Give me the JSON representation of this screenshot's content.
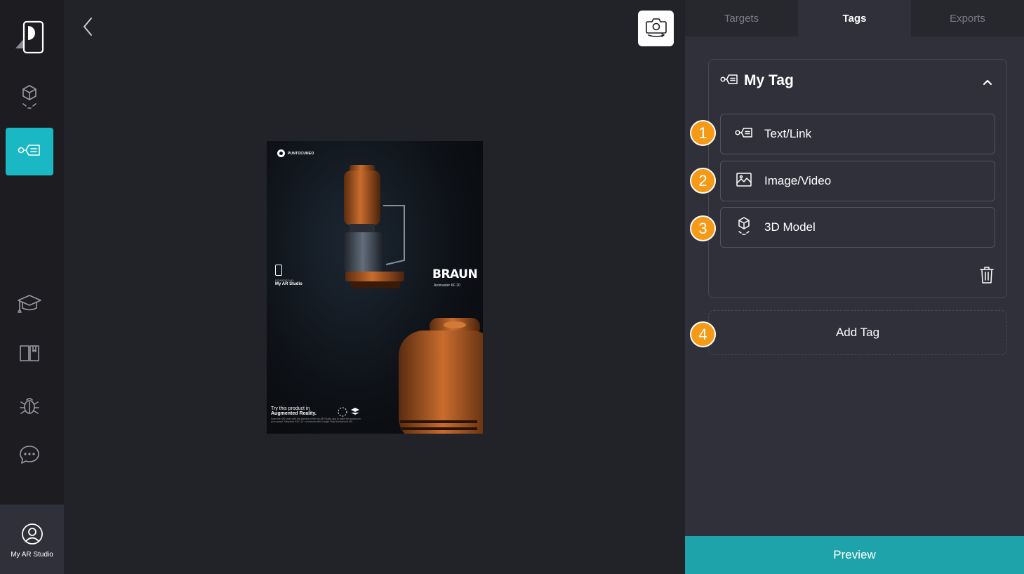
{
  "app": {
    "profile_label": "My AR Studio"
  },
  "sidebar": {
    "items": [
      {
        "icon": "cube-icon"
      },
      {
        "icon": "tag-icon",
        "active": true
      },
      {
        "icon": "graduation-cap-icon"
      },
      {
        "icon": "book-icon"
      },
      {
        "icon": "bug-icon"
      },
      {
        "icon": "chat-icon"
      }
    ]
  },
  "poster": {
    "brand": "PUNTOCUNEO",
    "powered_small": "POWERED BY",
    "powered_app": "My AR Studio",
    "logo_text": "BRAUN",
    "model_text": "Aromaster KF 20",
    "try_line1": "Try this product in",
    "try_line2": "Augmented Reality.",
    "try_fine": "Scan the QR code with the camera of the My AR Studio app to place the product in your space. Requires iOS 12+ or Android with Google Play Services for AR."
  },
  "tabs": [
    {
      "label": "Targets",
      "active": false
    },
    {
      "label": "Tags",
      "active": true
    },
    {
      "label": "Exports",
      "active": false
    }
  ],
  "tag_card": {
    "title": "My Tag",
    "options": [
      {
        "label": "Text/Link",
        "icon": "text-link-icon",
        "badge": "1"
      },
      {
        "label": "Image/Video",
        "icon": "image-icon",
        "badge": "2"
      },
      {
        "label": "3D Model",
        "icon": "cube-icon",
        "badge": "3"
      }
    ]
  },
  "add_tag": {
    "label": "Add Tag",
    "badge": "4"
  },
  "preview": {
    "label": "Preview"
  },
  "colors": {
    "accent": "#1ab8c4",
    "preview_bg": "#1fa3ab",
    "badge": "#f59a16",
    "panel": "#30303a",
    "sidebar": "#1c1c21",
    "canvas": "#222229"
  }
}
